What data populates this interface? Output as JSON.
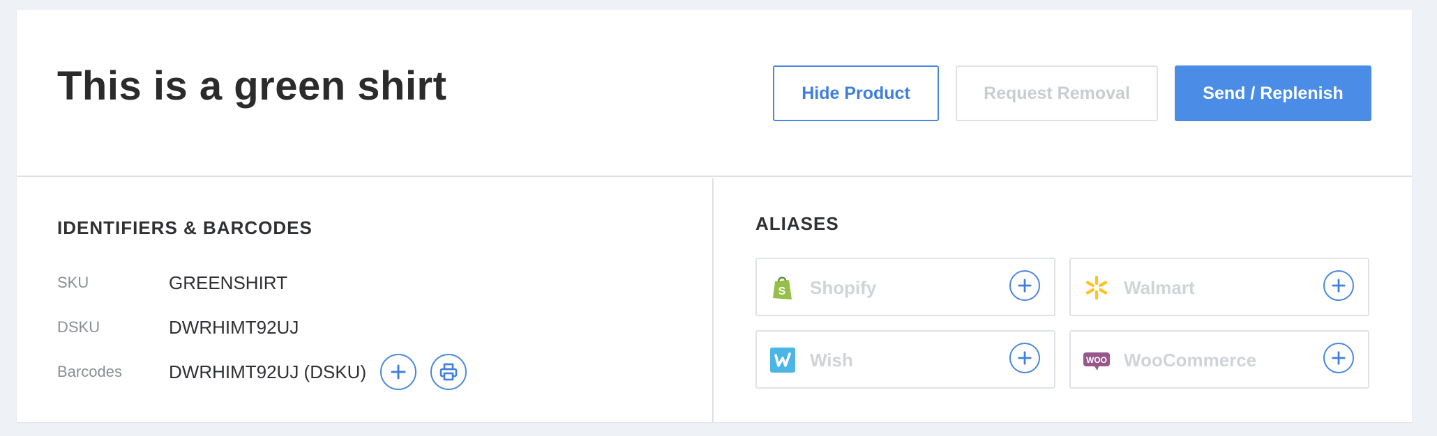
{
  "header": {
    "title": "This is a green shirt",
    "hide_label": "Hide Product",
    "removal_label": "Request Removal",
    "send_label": "Send / Replenish"
  },
  "identifiers": {
    "section_title": "IDENTIFIERS & BARCODES",
    "rows": [
      {
        "label": "SKU",
        "value": "GREENSHIRT"
      },
      {
        "label": "DSKU",
        "value": "DWRHIMT92UJ"
      },
      {
        "label": "Barcodes",
        "value": "DWRHIMT92UJ (DSKU)"
      }
    ],
    "add_icon": "plus-circle-icon",
    "print_icon": "printer-icon"
  },
  "aliases": {
    "section_title": "ALIASES",
    "items": [
      {
        "name": "Shopify",
        "icon": "shopify-icon",
        "color": "#95bf47"
      },
      {
        "name": "Walmart",
        "icon": "walmart-icon",
        "color": "#ffc220"
      },
      {
        "name": "Wish",
        "icon": "wish-icon",
        "color": "#4bb5e8"
      },
      {
        "name": "WooCommerce",
        "icon": "woocommerce-icon",
        "color": "#96588a"
      }
    ]
  },
  "colors": {
    "accent": "#4a8ce6",
    "disabled_text": "#c9ccd1",
    "title_text": "#2b2b2b"
  }
}
